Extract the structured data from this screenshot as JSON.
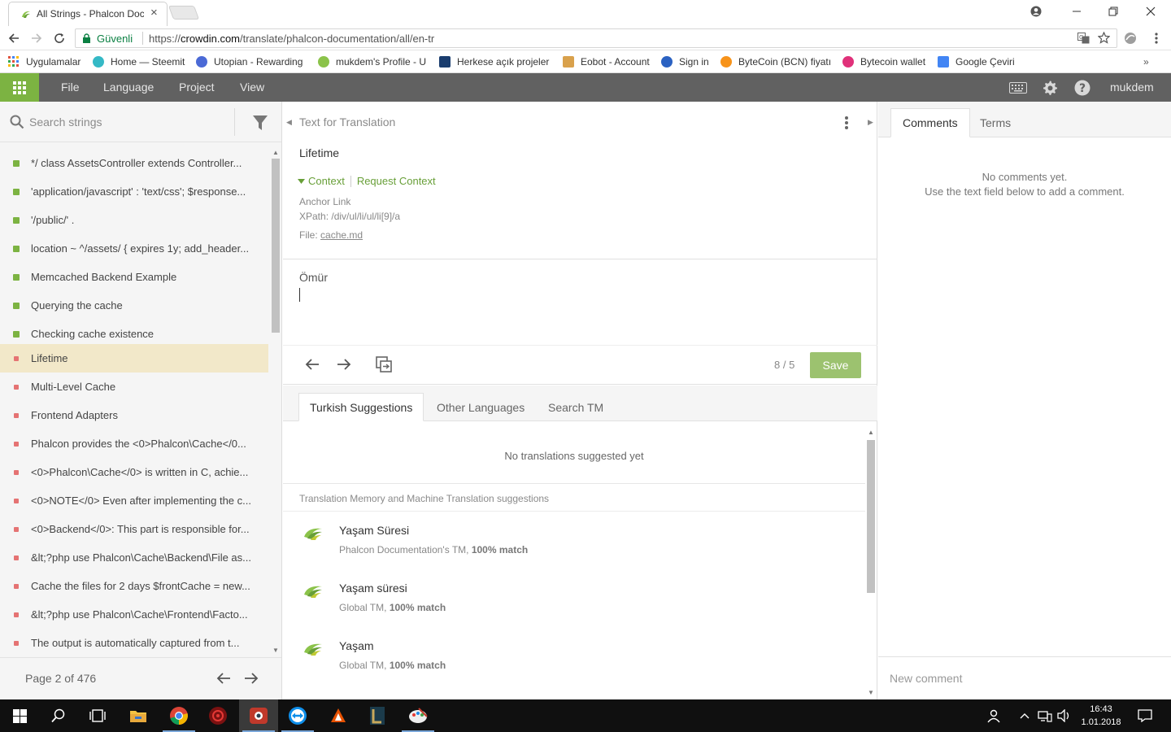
{
  "browser": {
    "tab_title": "All Strings - Phalcon Doc",
    "secure_label": "Güvenli",
    "url_scheme": "https://",
    "url_domain": "crowdin.com",
    "url_path": "/translate/phalcon-documentation/all/en-tr"
  },
  "bookmarks": [
    {
      "label": "Uygulamalar",
      "color": "#e0533d"
    },
    {
      "label": "Home — Steemit",
      "color": "#35b9c6"
    },
    {
      "label": "Utopian - Rewarding",
      "color": "#4b6ad6"
    },
    {
      "label": "mukdem's Profile - U",
      "color": "#8bc34a"
    },
    {
      "label": "Herkese açık projeler",
      "color": "#1a3d6e"
    },
    {
      "label": "Eobot - Account",
      "color": "#d9a14c"
    },
    {
      "label": "Sign in",
      "color": "#2b62c2"
    },
    {
      "label": "ByteCoin (BCN) fiyatı",
      "color": "#f7931a"
    },
    {
      "label": "Bytecoin wallet",
      "color": "#e0317a"
    },
    {
      "label": "Google Çeviri",
      "color": "#4285f4"
    }
  ],
  "menu": {
    "file": "File",
    "language": "Language",
    "project": "Project",
    "view": "View",
    "username": "mukdem"
  },
  "sidebar": {
    "search_placeholder": "Search strings",
    "pager_label": "Page 2 of 476",
    "items": [
      {
        "text": "*/ class AssetsController extends Controller...",
        "status": "translated"
      },
      {
        "text": "'application/javascript' : 'text/css'; $response...",
        "status": "translated"
      },
      {
        "text": "'/public/' .",
        "status": "translated"
      },
      {
        "text": "location ~ ^/assets/ { expires 1y; add_header...",
        "status": "translated"
      },
      {
        "text": "Memcached Backend Example",
        "status": "translated"
      },
      {
        "text": "Querying the cache",
        "status": "translated"
      },
      {
        "text": "Checking cache existence",
        "status": "translated"
      },
      {
        "text": "Lifetime",
        "status": "untranslated",
        "selected": true
      },
      {
        "text": "Multi-Level Cache",
        "status": "untranslated"
      },
      {
        "text": "Frontend Adapters",
        "status": "untranslated"
      },
      {
        "text": "Phalcon provides the <0>Phalcon\\Cache</0...",
        "status": "untranslated"
      },
      {
        "text": "<0>Phalcon\\Cache</0> is written in C, achie...",
        "status": "untranslated"
      },
      {
        "text": "<0>NOTE</0> Even after implementing the c...",
        "status": "untranslated"
      },
      {
        "text": "<0>Backend</0>: This part is responsible for...",
        "status": "untranslated"
      },
      {
        "text": "&lt;?php use Phalcon\\Cache\\Backend\\File as...",
        "status": "untranslated"
      },
      {
        "text": "Cache the files for 2 days $frontCache = new...",
        "status": "untranslated"
      },
      {
        "text": "&lt;?php use Phalcon\\Cache\\Frontend\\Facto...",
        "status": "untranslated"
      },
      {
        "text": "The output is automatically captured from t...",
        "status": "untranslated"
      }
    ]
  },
  "colors": {
    "translated": "#7cb342",
    "untranslated": "#e57373",
    "accent": "#7cb342",
    "link": "#689f38"
  },
  "source": {
    "header": "Text for Translation",
    "text": "Lifetime",
    "context_label": "Context",
    "request_context_label": "Request Context",
    "anchor": "Anchor Link",
    "xpath": "XPath: /div/ul/li/ul/li[9]/a",
    "file_prefix": "File: ",
    "file_name": "cache.md"
  },
  "translation": {
    "text": "Ömür",
    "counter": "8 / 5",
    "save_label": "Save"
  },
  "suggestions": {
    "tabs": [
      "Turkish Suggestions",
      "Other Languages",
      "Search TM"
    ],
    "empty_message": "No translations suggested yet",
    "tm_header": "Translation Memory and Machine Translation suggestions",
    "items": [
      {
        "text": "Yaşam Süresi",
        "source": "Phalcon Documentation's TM,",
        "match": "100% match"
      },
      {
        "text": "Yaşam süresi",
        "source": "Global TM,",
        "match": "100% match"
      },
      {
        "text": "Yaşam",
        "source": "Global TM,",
        "match": "100% match"
      }
    ]
  },
  "comments": {
    "tabs": [
      "Comments",
      "Terms"
    ],
    "empty_line1": "No comments yet.",
    "empty_line2": "Use the text field below to add a comment.",
    "input_placeholder": "New comment"
  },
  "taskbar": {
    "time": "16:43",
    "date": "1.01.2018"
  }
}
